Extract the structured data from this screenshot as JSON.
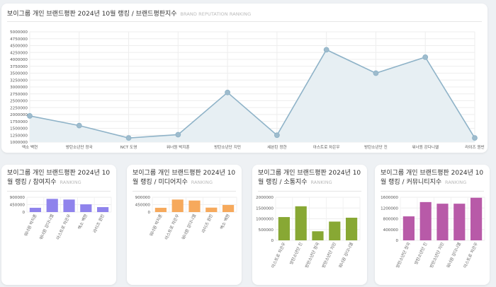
{
  "main": {
    "title": "보이그룹 개인 브랜드평판 2024년 10월 랭킹 / 브랜드평판지수",
    "subtitle": "BRAND REPUTATION RANKING"
  },
  "cards": [
    {
      "title": "보이그룹 개인 브랜드평판 2024년 10월 랭킹 / 참여지수",
      "subtitle": "RANKING"
    },
    {
      "title": "보이그룹 개인 브랜드평판 2024년 10월 랭킹 / 미디어지수",
      "subtitle": "RANKING"
    },
    {
      "title": "보이그룹 개인 브랜드평판 2024년 10월 랭킹 / 소통지수",
      "subtitle": "RANKING"
    },
    {
      "title": "보이그룹 개인 브랜드평판 2024년 10월 랭킹 / 커뮤니티지수",
      "subtitle": "RANKING"
    }
  ],
  "chart_data": [
    {
      "type": "line",
      "categories": [
        "엑소 백현",
        "방탄소년단 정국",
        "NCT 도영",
        "워너원 박지훈",
        "방탄소년단 지민",
        "세븐틴 정한",
        "아스트로 차은우",
        "방탄소년단 진",
        "워너원 강다니엘",
        "라이즈 원빈"
      ],
      "values": [
        1950000,
        1600000,
        1150000,
        1270000,
        2800000,
        1250000,
        4350000,
        3500000,
        4080000,
        1150000
      ],
      "ylim": [
        1000000,
        5000000
      ],
      "yticks": [
        "1000000",
        "1250000",
        "1500000",
        "1750000",
        "2000000",
        "2250000",
        "2500000",
        "2750000",
        "3000000",
        "3250000",
        "3500000",
        "3750000",
        "4000000",
        "4250000",
        "4500000",
        "4750000",
        "5000000"
      ],
      "color": "#8fb3c8",
      "fill": "#e7eff3",
      "grid": true
    },
    {
      "type": "bar",
      "categories": [
        "워너원 박지훈",
        "워너원 강다니엘",
        "아스트로 차은우",
        "엑소 백현",
        "라이즈 원빈"
      ],
      "values": [
        260000,
        800000,
        760000,
        470000,
        300000
      ],
      "ylim": [
        0,
        900000
      ],
      "yticks": [
        "0",
        "450000",
        "900000"
      ],
      "color": "#8f83ec"
    },
    {
      "type": "bar",
      "categories": [
        "워너원 박지훈",
        "아스트로 차은우",
        "워너원 강다니엘",
        "라이즈 원빈",
        "엑소 백현"
      ],
      "values": [
        260000,
        760000,
        700000,
        270000,
        430000
      ],
      "ylim": [
        0,
        900000
      ],
      "yticks": [
        "0",
        "450000",
        "900000"
      ],
      "color": "#f6a95c"
    },
    {
      "type": "bar",
      "categories": [
        "아스트로 차은우",
        "방탄소년단 진",
        "방탄소년단 정국",
        "방탄소년단 지민",
        "워너원 강다니엘"
      ],
      "values": [
        1080000,
        1580000,
        420000,
        870000,
        1050000
      ],
      "ylim": [
        0,
        2000000
      ],
      "yticks": [
        "0",
        "500000",
        "1000000",
        "1500000",
        "2000000"
      ],
      "color": "#88a834"
    },
    {
      "type": "bar",
      "categories": [
        "방탄소년단 정국",
        "방탄소년단 진",
        "방탄소년단 지민",
        "워너원 강다니엘",
        "아스트로 차은우"
      ],
      "values": [
        890000,
        1420000,
        1360000,
        1360000,
        1580000
      ],
      "ylim": [
        0,
        1600000
      ],
      "yticks": [
        "0",
        "400000",
        "800000",
        "1200000",
        "1600000"
      ],
      "color": "#b85aa8"
    }
  ]
}
